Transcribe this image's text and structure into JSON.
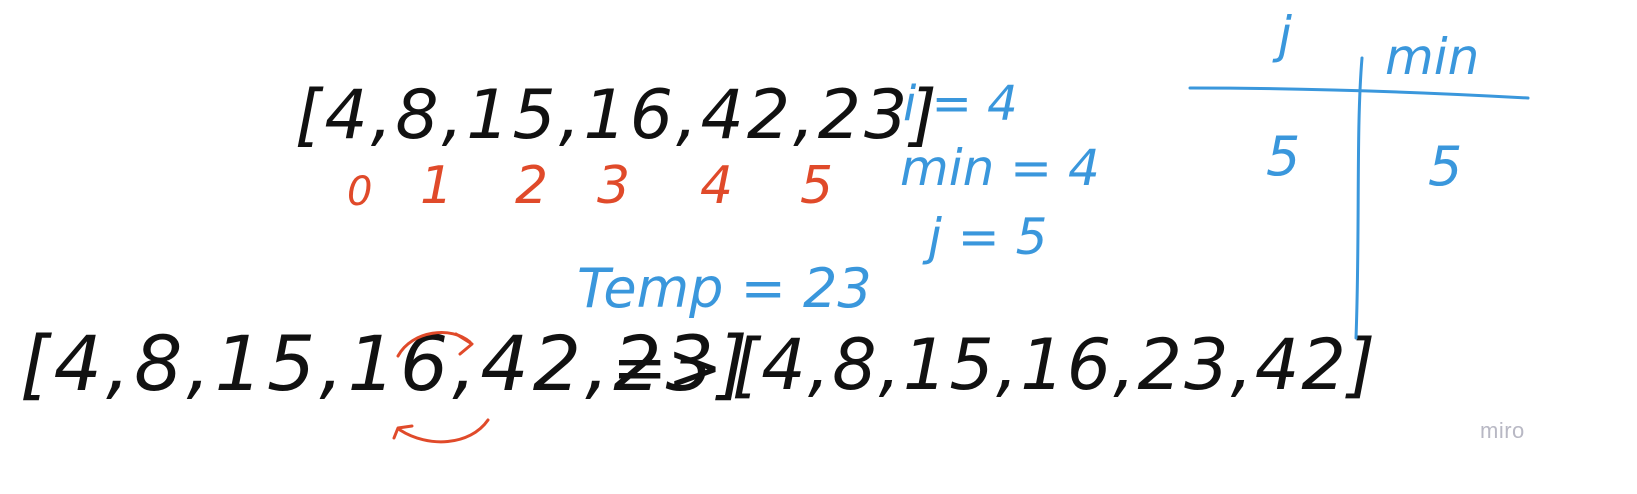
{
  "colors": {
    "ink_black": "#111111",
    "ink_red": "#e04a2a",
    "ink_blue": "#3a97dc",
    "watermark": "#b8b8c4",
    "canvas": "#ffffff"
  },
  "sketch": {
    "array_top": "[4,8,15,16,42,23]",
    "indices": [
      "0",
      "1",
      "2",
      "3",
      "4",
      "5"
    ],
    "vars": {
      "i": "i = 4",
      "min": "min = 4",
      "j": "j = 5"
    },
    "temp": "Temp = 23",
    "array_bottom": "[4,8,15,16,42,23]",
    "arrow": "=>",
    "array_result": "[4,8,15,16,23,42]",
    "swap_arrows_icon": "curved-swap-arrows-icon"
  },
  "trace_table": {
    "headers": [
      "j",
      "min"
    ],
    "rows": [
      [
        "5",
        "5"
      ]
    ]
  },
  "watermark": "miro"
}
